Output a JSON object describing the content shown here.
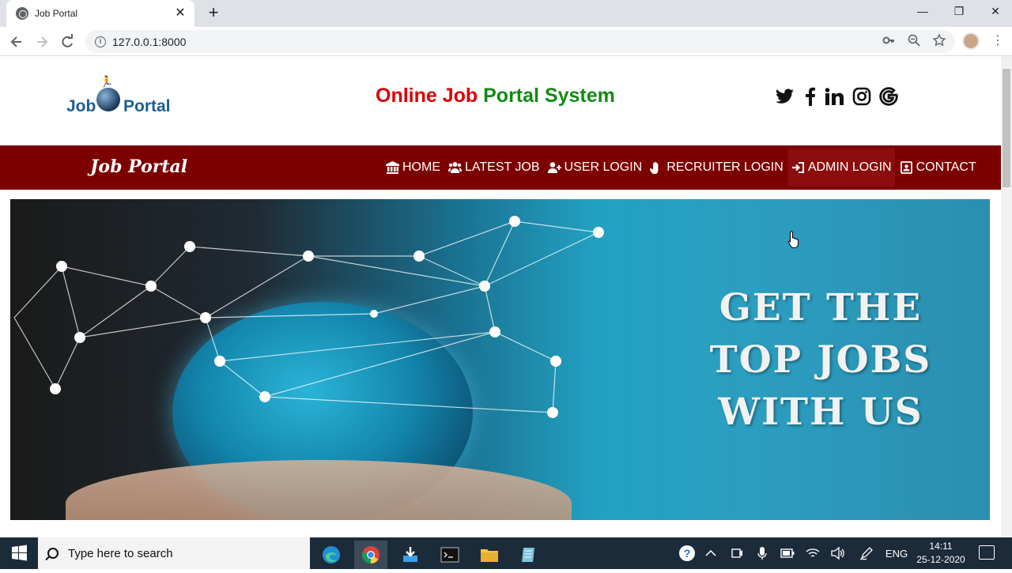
{
  "browser": {
    "tab_title": "Job Portal",
    "tab_close": "✕",
    "new_tab": "+",
    "url": "127.0.0.1:8000",
    "window_controls": [
      "—",
      "❐",
      "✕"
    ]
  },
  "site": {
    "logo_word1": "Job",
    "logo_word2": "Portal",
    "title_part1": "Online Job ",
    "title_part2": "Portal System",
    "social_icons": [
      "twitter-icon",
      "facebook-icon",
      "linkedin-icon",
      "instagram-icon",
      "google-icon"
    ],
    "brand": "Job Portal",
    "nav": [
      {
        "label": "HOME",
        "icon": "bank-icon"
      },
      {
        "label": "LATEST JOB",
        "icon": "users-icon"
      },
      {
        "label": "USER LOGIN",
        "icon": "user-plus-icon"
      },
      {
        "label": "RECRUITER LOGIN",
        "icon": "hand-icon"
      },
      {
        "label": "ADMIN LOGIN",
        "icon": "sign-in-icon",
        "active": true
      },
      {
        "label": "CONTACT",
        "icon": "contact-card-icon"
      }
    ],
    "hero_line1": "GET THE",
    "hero_line2": "TOP JOBS",
    "hero_line3": "WITH US"
  },
  "taskbar": {
    "search_placeholder": "Type here to search",
    "language": "ENG",
    "time": "14:11",
    "date": "25-12-2020"
  },
  "colors": {
    "navbar": "#7d0000",
    "title_red": "#d90000",
    "title_green": "#138a13",
    "taskbar": "#1c2b3a"
  }
}
